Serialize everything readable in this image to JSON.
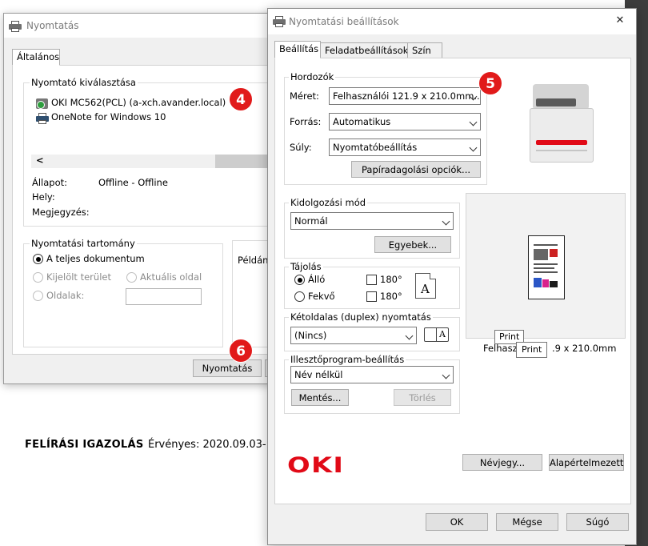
{
  "print_dialog": {
    "title": "Nyomtatás",
    "tab_general": "Általános",
    "printer_group": "Nyomtató kiválasztása",
    "printers": [
      "OKI MC562(PCL) (a-xch.avander.local)",
      "OneNote for Windows 10"
    ],
    "scroll_left": "<",
    "status_label": "Állapot:",
    "status_value": "Offline - Offline",
    "location_label": "Hely:",
    "comment_label": "Megjegyzés:",
    "range_group": "Nyomtatási tartomány",
    "range_all": "A teljes dokumentum",
    "range_selection": "Kijelölt terület",
    "range_current": "Aktuális oldal",
    "range_pages": "Oldalak:",
    "copies_label": "Példány",
    "print_button": "Nyomtatás"
  },
  "settings_dialog": {
    "title": "Nyomtatási beállítások",
    "close": "✕",
    "tabs": [
      "Beállítás",
      "Feladatbeállítások",
      "Szín"
    ],
    "media_group": "Hordozók",
    "size_label": "Méret:",
    "size_value": "Felhasználói 121.9 x 210.0mm...",
    "source_label": "Forrás:",
    "source_value": "Automatikus",
    "weight_label": "Súly:",
    "weight_value": "Nyomtatóbeállítás",
    "paper_options_button": "Papíradagolási opciók...",
    "finishing_group": "Kidolgozási mód",
    "finishing_value": "Normál",
    "others_button": "Egyebek...",
    "orientation_group": "Tájolás",
    "portrait": "Álló",
    "landscape": "Fekvő",
    "rotate_180": "180°",
    "duplex_group": "Kétoldalas (duplex) nyomtatás",
    "duplex_value": "(Nincs)",
    "driver_group": "Illesztőprogram-beállítás",
    "driver_value": "Név nélkül",
    "save_button": "Mentés...",
    "delete_button": "Törlés",
    "preview_caption_left": "Felhasz",
    "preview_caption_right": ".9 x 210.0mm",
    "tooltip_1": "Print",
    "tooltip_2": "Print",
    "about_button": "Névjegy...",
    "defaults_button": "Alapértelmezett",
    "ok_button": "OK",
    "cancel_button": "Mégse",
    "help_button": "Súgó",
    "logo": "OKI"
  },
  "badges": [
    "4",
    "5",
    "6"
  ],
  "background_text": {
    "heading": "FELÍRÁSI IGAZOLÁS",
    "valid": "Érvényes: 2020.09.03-"
  }
}
